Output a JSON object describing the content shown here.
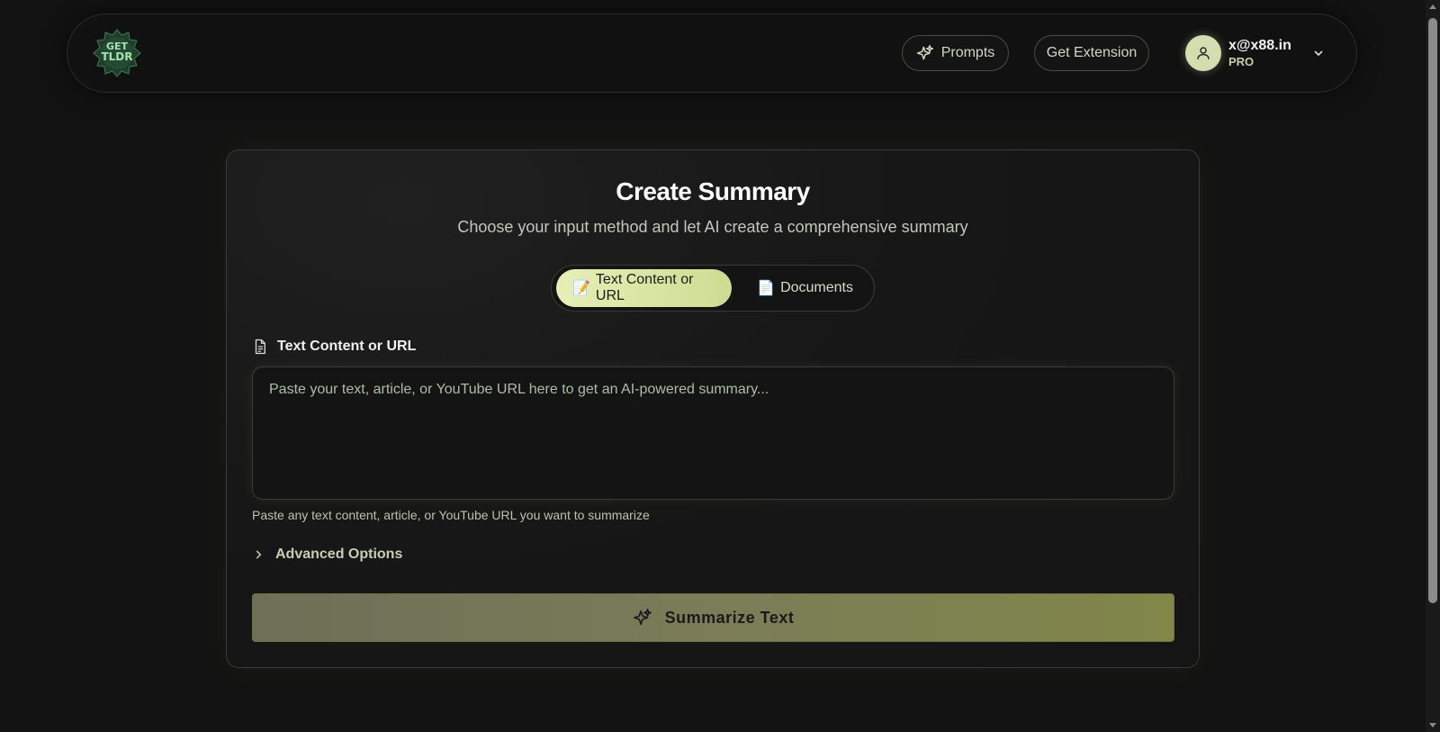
{
  "header": {
    "logo_alt": "GET TLDR",
    "prompts_label": "Prompts",
    "extension_label": "Get Extension",
    "user": {
      "email": "x@x88.in",
      "plan": "PRO"
    }
  },
  "card": {
    "title": "Create Summary",
    "subtitle": "Choose your input method and let AI create a comprehensive summary",
    "tabs": [
      {
        "emoji": "📝",
        "label": "Text Content or URL",
        "active": true
      },
      {
        "emoji": "📄",
        "label": "Documents",
        "active": false
      }
    ],
    "field_label": "Text Content or URL",
    "placeholder": "Paste your text, article, or YouTube URL here to get an AI-powered summary...",
    "helper": "Paste any text content, article, or YouTube URL you want to summarize",
    "advanced_label": "Advanced Options",
    "submit_label": "Summarize Text"
  },
  "icons": {
    "prompts": "sparkles-icon",
    "user": "user-icon",
    "dropdown": "chevron-down-icon",
    "field": "document-icon",
    "advanced": "chevron-right-icon",
    "submit": "sparkles-icon"
  },
  "colors": {
    "background": "#121212",
    "accent": "#d3deb0",
    "submit_gradient_start": "#6d6f57",
    "submit_gradient_end": "#818649"
  }
}
